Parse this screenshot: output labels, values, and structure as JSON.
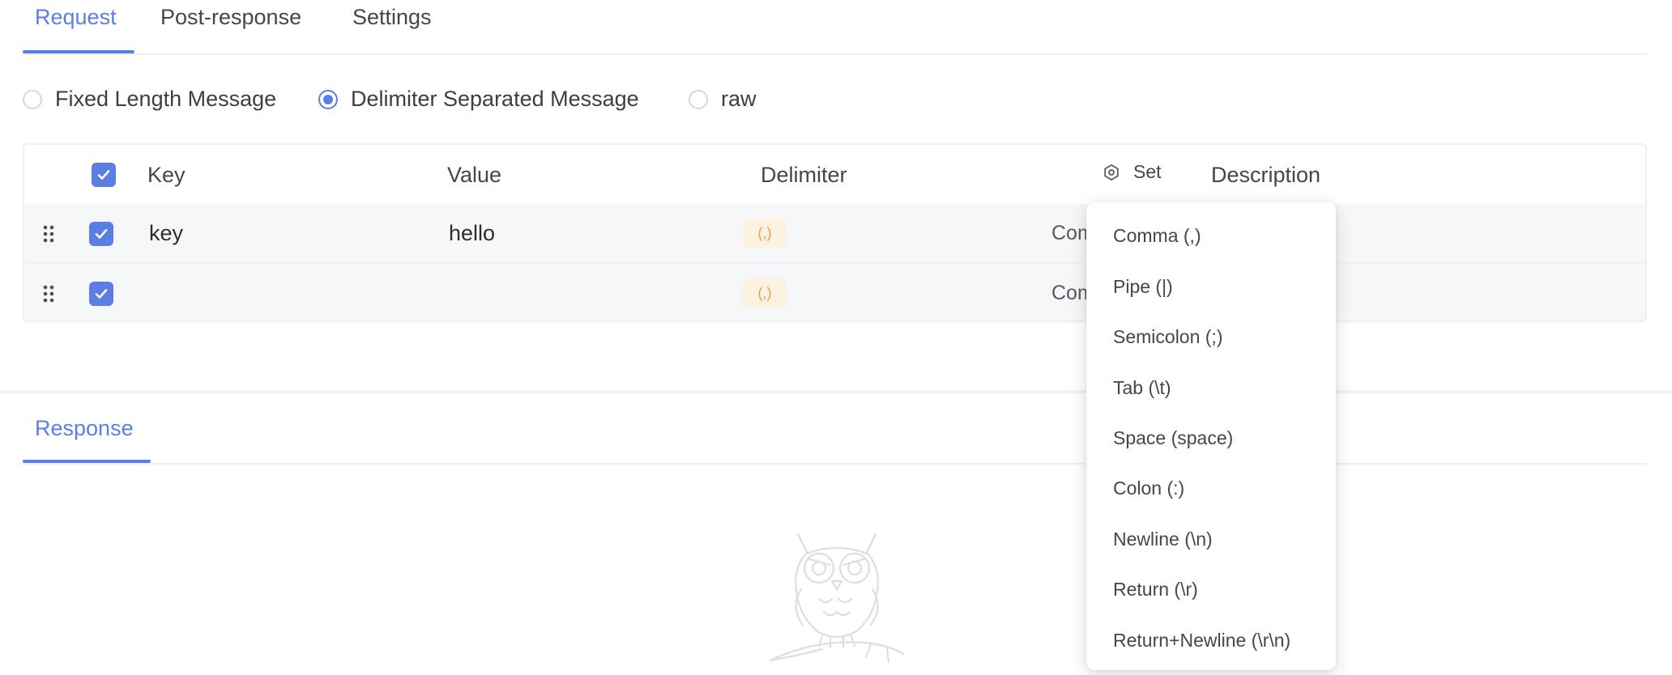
{
  "tabs": {
    "request": "Request",
    "post_response": "Post-response",
    "settings": "Settings"
  },
  "message_type": {
    "options": [
      "Fixed Length Message",
      "Delimiter Separated Message",
      "raw"
    ],
    "selected": "Delimiter Separated Message"
  },
  "table": {
    "headers": {
      "key": "Key",
      "value": "Value",
      "delimiter": "Delimiter",
      "set": "Set",
      "description": "Description"
    },
    "rows": [
      {
        "checked": true,
        "key": "key",
        "value": "hello",
        "delimiter_badge": "(,)",
        "delimiter_partial": "Com"
      },
      {
        "checked": true,
        "key": "",
        "value": "",
        "delimiter_badge": "(,)",
        "delimiter_partial": "Com"
      }
    ]
  },
  "delimiter_menu": {
    "options": [
      "Comma (,)",
      "Pipe (|)",
      "Semicolon (;)",
      "Tab (\\t)",
      "Space (space)",
      "Colon (:)",
      "Newline (\\n)",
      "Return (\\r)",
      "Return+Newline (\\r\\n)"
    ]
  },
  "response": {
    "tab": "Response"
  },
  "icons": {
    "checkbox": "check-icon",
    "drag": "drag-handle-icon",
    "set": "gear-icon",
    "empty": "owl-empty-state-icon"
  },
  "colors": {
    "accent": "#5b7ee5",
    "badge_bg": "#fdf1e2",
    "badge_text": "#e8a43b",
    "row_bg": "#f6f7f9"
  }
}
